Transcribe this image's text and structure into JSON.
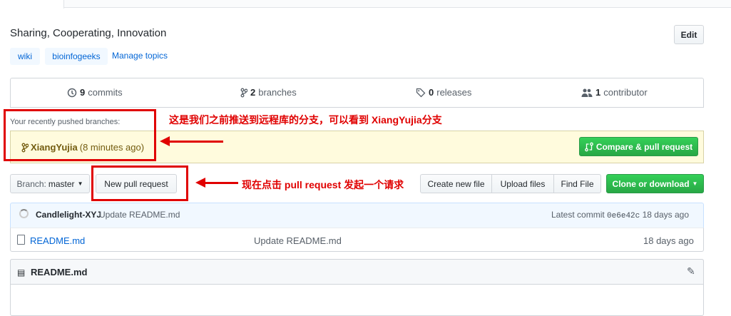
{
  "repo": {
    "description": "Sharing, Cooperating, Innovation",
    "edit_label": "Edit",
    "topics": [
      "wiki",
      "bioinfogeeks"
    ],
    "manage_topics": "Manage topics"
  },
  "summary": {
    "commits_count": "9",
    "commits_label": "commits",
    "branches_count": "2",
    "branches_label": "branches",
    "releases_count": "0",
    "releases_label": "releases",
    "contributors_count": "1",
    "contributors_label": "contributor"
  },
  "pushed": {
    "label": "Your recently pushed branches:",
    "branch": "XiangYujia",
    "time": "(8 minutes ago)",
    "compare_button": "Compare & pull request"
  },
  "toolbar": {
    "branch_prefix": "Branch:",
    "branch_value": "master",
    "new_pull_request": "New pull request",
    "create_new_file": "Create new file",
    "upload_files": "Upload files",
    "find_file": "Find File",
    "clone_or_download": "Clone or download"
  },
  "commit": {
    "author": "Candlelight-XYJ",
    "message": "Update README.md",
    "latest_label": "Latest commit",
    "sha": "0e6e42c",
    "age": "18 days ago"
  },
  "files": [
    {
      "name": "README.md",
      "message": "Update README.md",
      "age": "18 days ago"
    }
  ],
  "readme": {
    "title": "README.md"
  },
  "annotations": {
    "note_branch": "这是我们之前推送到远程库的分支，可以看到 XiangYujia分支",
    "note_pr": "现在点击 pull request 发起一个请求",
    "color": "#e00000"
  }
}
